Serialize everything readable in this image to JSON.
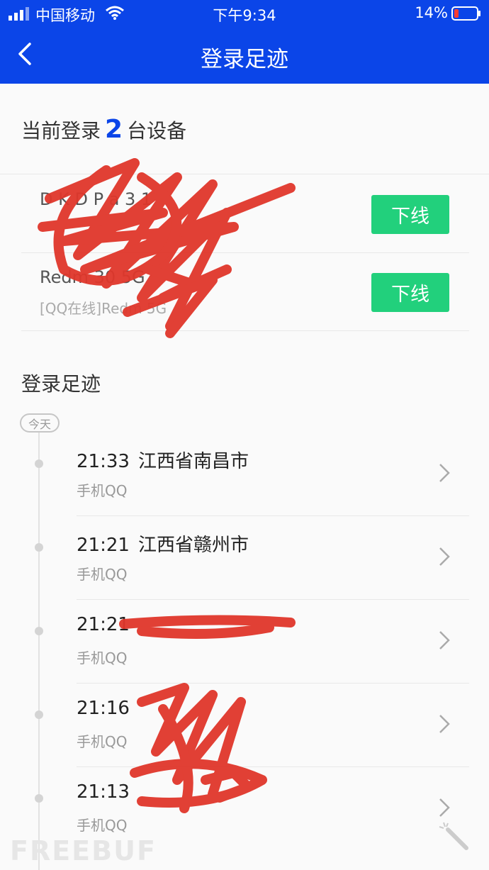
{
  "status_bar": {
    "carrier": "中国移动",
    "time": "下午9:34",
    "battery": "14%"
  },
  "nav": {
    "title": "登录足迹",
    "back_icon": "chevron-left-icon"
  },
  "current_login": {
    "prefix": "当前登录",
    "count": "2",
    "suffix": "台设备",
    "devices": [
      {
        "name": "D  K  D  P  a  3 1",
        "desc": "",
        "button": "下线"
      },
      {
        "name": "Redm  30  5G",
        "desc": "[QQ在线]Redm  5G",
        "button": "下线"
      }
    ]
  },
  "footprint": {
    "heading": "登录足迹",
    "day_label": "今天",
    "records": [
      {
        "time": "21:33",
        "location": "江西省南昌市",
        "client": "手机QQ"
      },
      {
        "time": "21:21",
        "location": "江西省赣州市",
        "client": "手机QQ"
      },
      {
        "time": "21:21",
        "location": "",
        "client": "手机QQ"
      },
      {
        "time": "21:16",
        "location": "",
        "client": "手机QQ"
      },
      {
        "time": "21:13",
        "location": "",
        "client": "手机QQ"
      }
    ]
  },
  "watermark": "FREEBUF",
  "colors": {
    "brand_blue": "#0b45e8",
    "offline_green": "#22d07c",
    "scribble_red": "#e0372b"
  }
}
